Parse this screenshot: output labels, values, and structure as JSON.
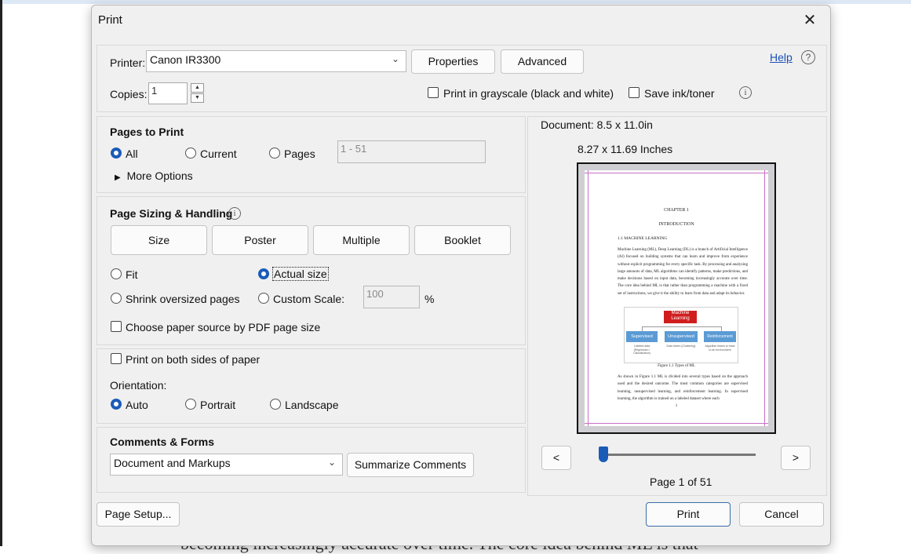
{
  "window": {
    "title": "Print",
    "close_glyph": "✕"
  },
  "background_text": "becoming increasingly accurate over time. The core idea behind ML is that",
  "printer": {
    "label": "Printer:",
    "value": "Canon IR3300",
    "properties_label": "Properties",
    "advanced_label": "Advanced",
    "help_label": "Help",
    "help_icon": "?"
  },
  "copies": {
    "label": "Copies:",
    "value": "1"
  },
  "options": {
    "grayscale_label": "Print in grayscale (black and white)",
    "grayscale_checked": false,
    "save_ink_label": "Save ink/toner",
    "save_ink_checked": false,
    "info_icon": "i"
  },
  "pages_to_print": {
    "heading": "Pages to Print",
    "all_label": "All",
    "current_label": "Current",
    "pages_label": "Pages",
    "pages_range": "1 - 51",
    "selected": "All",
    "more_options_label": "More Options"
  },
  "sizing": {
    "heading": "Page Sizing & Handling",
    "info_icon": "i",
    "tabs": [
      "Size",
      "Poster",
      "Multiple",
      "Booklet"
    ],
    "fit_label": "Fit",
    "actual_size_label": "Actual size",
    "shrink_label": "Shrink oversized pages",
    "custom_scale_label": "Custom Scale:",
    "custom_scale_value": "100",
    "percent": "%",
    "selected": "Actual size",
    "paper_source_label": "Choose paper source by PDF page size",
    "paper_source_checked": false
  },
  "duplex": {
    "both_sides_label": "Print on both sides of paper",
    "both_sides_checked": false,
    "orientation_label": "Orientation:",
    "auto_label": "Auto",
    "portrait_label": "Portrait",
    "landscape_label": "Landscape",
    "selected": "Auto"
  },
  "comments": {
    "heading": "Comments & Forms",
    "value": "Document and Markups",
    "summarize_label": "Summarize Comments"
  },
  "preview": {
    "document_size": "Document: 8.5 x 11.0in",
    "paper_size": "8.27 x 11.69 Inches",
    "prev_label": "<",
    "next_label": ">",
    "page_indicator": "Page 1 of 51",
    "slider_position": 0.0,
    "doc": {
      "chapter": "CHAPTER 1",
      "heading": "INTRODUCTION",
      "section": "1.1    MACHINE LEARNING",
      "paragraph1": "Machine Learning (ML), Deep Learning (DL) is a branch of Artificial Intelligence (AI) focused on building systems that can learn and improve from experience without explicit programming for every specific task. By processing and analyzing large amounts of data, ML algorithms can identify patterns, make predictions, and make decisions based on input data, becoming increasingly accurate over time. The core idea behind ML is that rather than programming a machine with a fixed set of instructions, we give it the ability to learn from data and adapt its behavior.",
      "diagram_root": "Machine Learning",
      "diagram_children": [
        "Supervised",
        "Unsupervised",
        "Reinforcement"
      ],
      "diagram_notes": [
        "Labeled data (Regression / Classification)",
        "Data driven (Clustering)",
        "Algorithm learns to react to an environment"
      ],
      "figure_caption": "Figure 1.1 Types of ML",
      "paragraph2": "As shown in Figure 1.1 ML is divided into several types based on the approach used and the desired outcome. The most common categories are supervised learning, unsupervised learning, and reinforcement learning. In supervised learning, the algorithm is trained on a labeled dataset where each",
      "page_number": "1"
    }
  },
  "footer": {
    "page_setup_label": "Page Setup...",
    "print_label": "Print",
    "cancel_label": "Cancel"
  },
  "colors": {
    "accent": "#1a5bb8",
    "dialog_bg": "#f0f0f0",
    "diagram_red": "#d01e1e",
    "diagram_blue": "#5b9bd5",
    "margin_lines": "#c76fc6"
  }
}
